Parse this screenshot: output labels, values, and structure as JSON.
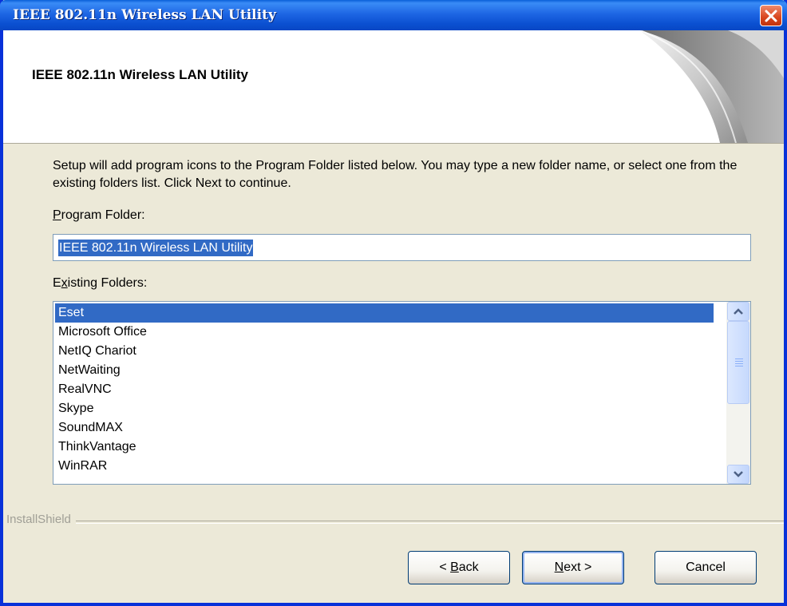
{
  "window": {
    "title": "IEEE 802.11n Wireless LAN Utility"
  },
  "header": {
    "title": "IEEE 802.11n Wireless LAN Utility"
  },
  "main": {
    "description": "Setup will add program icons to the Program Folder listed below.  You may type a new folder name, or select one from the existing folders list.  Click Next to continue.",
    "program_folder_label": {
      "accel": "P",
      "rest": "rogram Folder:"
    },
    "program_folder_value": "IEEE 802.11n Wireless LAN Utility",
    "existing_folders_label": {
      "pre": "E",
      "accel": "x",
      "rest": "isting Folders:"
    },
    "existing_folders": [
      "Eset",
      "Microsoft Office",
      "NetIQ Chariot",
      "NetWaiting",
      "RealVNC",
      "Skype",
      "SoundMAX",
      "ThinkVantage",
      "WinRAR"
    ],
    "selected_folder": "Eset"
  },
  "footer": {
    "brand": "InstallShield",
    "back": {
      "pre": "< ",
      "accel": "B",
      "rest": "ack"
    },
    "next": {
      "accel": "N",
      "rest": "ext >"
    },
    "cancel": "Cancel"
  },
  "colors": {
    "titlebar": "#0a4fd0",
    "selection": "#316ac5",
    "dialog_bg": "#ece9d8"
  },
  "icons": {
    "close": "close-icon",
    "scroll_up": "chevron-up-icon",
    "scroll_down": "chevron-down-icon"
  }
}
